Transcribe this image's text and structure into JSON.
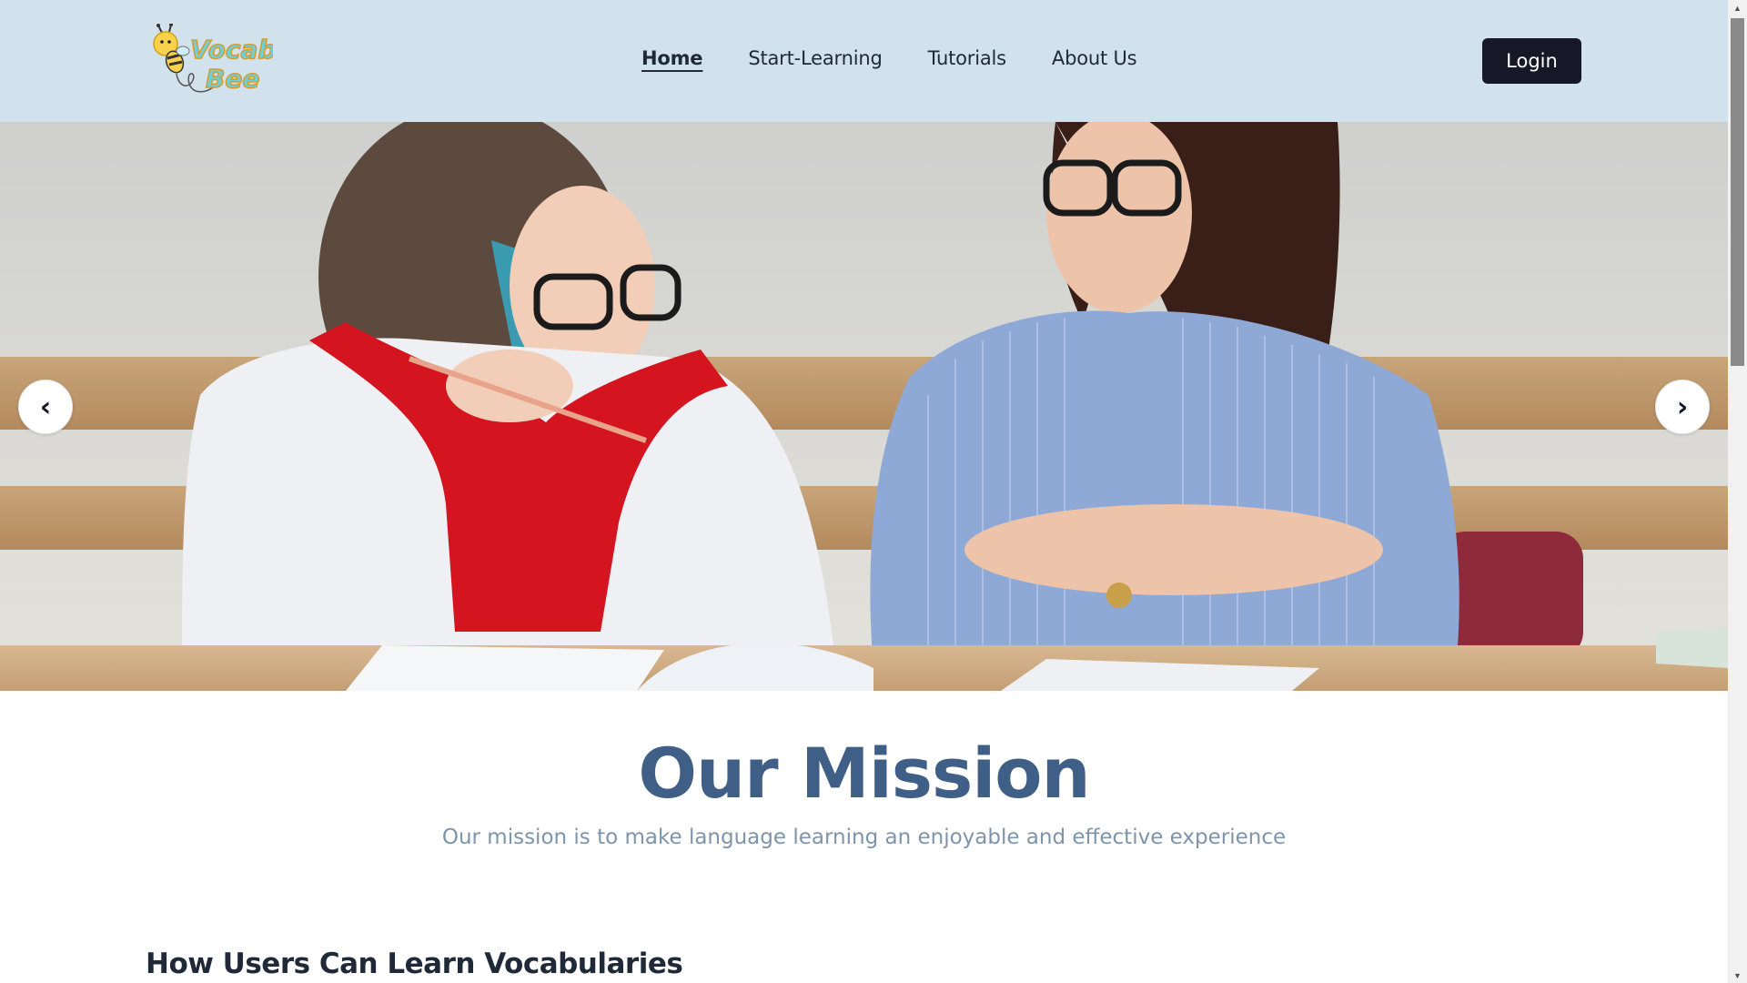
{
  "header": {
    "logo_text": "Vocab Bee",
    "nav": [
      {
        "label": "Home",
        "active": true
      },
      {
        "label": "Start-Learning",
        "active": false
      },
      {
        "label": "Tutorials",
        "active": false
      },
      {
        "label": "About Us",
        "active": false
      }
    ],
    "login_label": "Login"
  },
  "hero": {
    "prev_label": "‹",
    "next_label": "›"
  },
  "mission": {
    "title": "Our Mission",
    "subtitle": "Our mission is to make language learning an enjoyable and effective experience"
  },
  "section": {
    "title": "How Users Can Learn Vocabularies"
  },
  "colors": {
    "header_bg": "#d1e2ec",
    "login_bg": "#161827",
    "mission_title": "#3f5f87",
    "mission_sub": "#7e94ab"
  },
  "icons": {
    "prev": "chevron-left-icon",
    "next": "chevron-right-icon",
    "logo": "bee-logo-icon"
  }
}
